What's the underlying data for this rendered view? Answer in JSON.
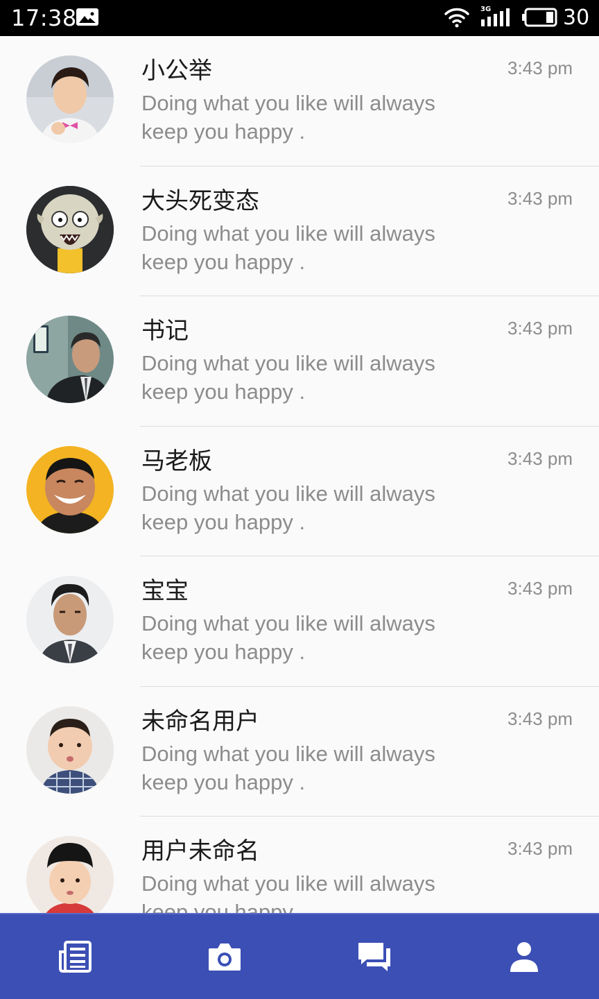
{
  "status_bar": {
    "time": "17:38",
    "network": "3G",
    "battery_level": "30",
    "icons": [
      "image-notification-icon",
      "wifi-icon",
      "cell-signal-icon",
      "battery-icon"
    ]
  },
  "chats": [
    {
      "name": "小公举",
      "message": "Doing what you like will always keep you happy .",
      "time": "3:43 pm",
      "avatar": "avatar-young-man-pink-bowtie"
    },
    {
      "name": "大头死变态",
      "message": "Doing what you like will always keep you happy .",
      "time": "3:43 pm",
      "avatar": "avatar-fish-mask"
    },
    {
      "name": "书记",
      "message": "Doing what you like will always keep you happy .",
      "time": "3:43 pm",
      "avatar": "avatar-man-in-suit-office"
    },
    {
      "name": "马老板",
      "message": "Doing what you like will always keep you happy .",
      "time": "3:43 pm",
      "avatar": "avatar-smiling-man-yellow"
    },
    {
      "name": "宝宝",
      "message": "Doing what you like will always keep you happy .",
      "time": "3:43 pm",
      "avatar": "avatar-man-dark-suit"
    },
    {
      "name": "未命名用户",
      "message": "Doing what you like will always keep you happy .",
      "time": "3:43 pm",
      "avatar": "avatar-toddler-plaid-shirt"
    },
    {
      "name": "用户未命名",
      "message": "Doing what you like will always keep you happy .",
      "time": "3:43 pm",
      "avatar": "avatar-toddler-black-hat"
    }
  ],
  "colors": {
    "nav_background": "#3c4fb5",
    "list_background": "#fafafa",
    "name_text": "#1a1a1a",
    "secondary_text": "#8c8c8c",
    "divider": "#dcdcdc"
  },
  "bottom_nav": {
    "items": [
      {
        "icon": "news-icon"
      },
      {
        "icon": "camera-icon"
      },
      {
        "icon": "chat-icon"
      },
      {
        "icon": "person-icon"
      }
    ]
  }
}
